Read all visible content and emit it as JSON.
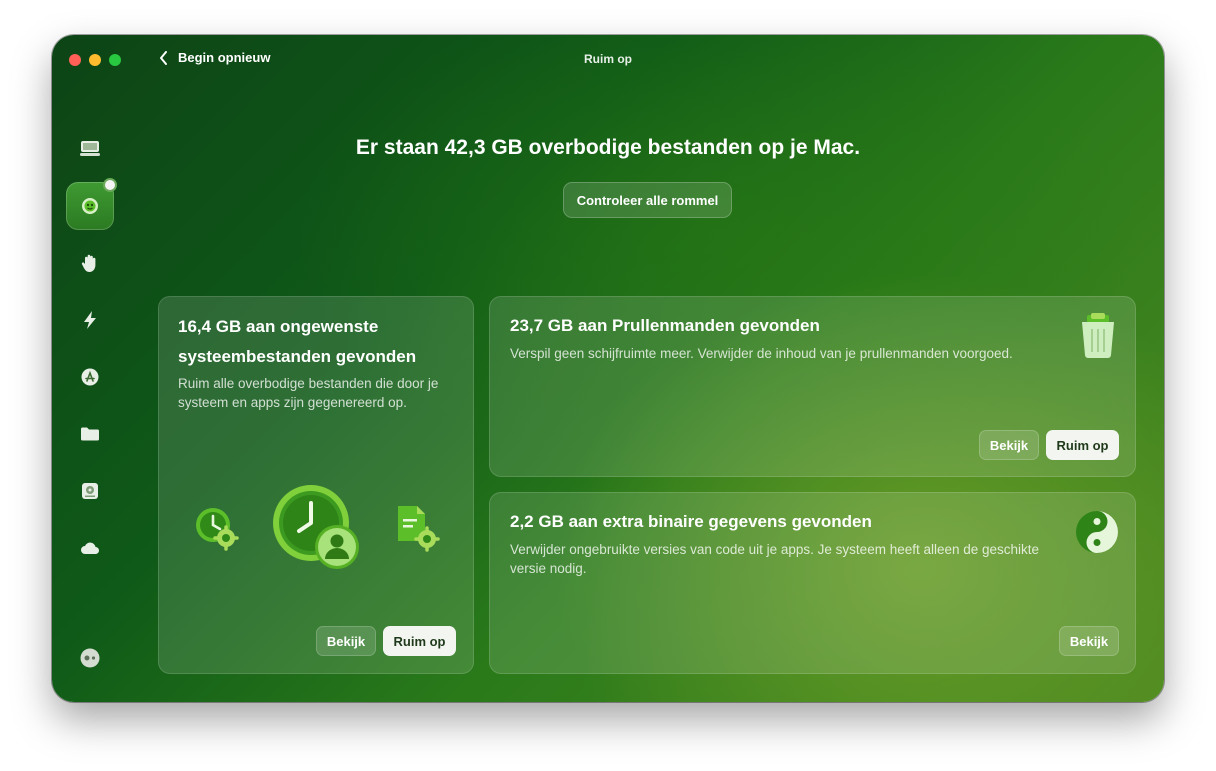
{
  "window": {
    "title": "Ruim op",
    "back_label": "Begin opnieuw"
  },
  "sidebar": {
    "items": [
      {
        "icon": "monitor-icon"
      },
      {
        "icon": "cleanup-icon",
        "active": true
      },
      {
        "icon": "hand-icon"
      },
      {
        "icon": "lightning-icon"
      },
      {
        "icon": "app-store-icon"
      },
      {
        "icon": "folder-icon"
      },
      {
        "icon": "disk-icon"
      },
      {
        "icon": "cloud-icon"
      }
    ],
    "bottom_icon": "assistant-icon"
  },
  "main": {
    "headline": "Er staan 42,3 GB overbodige bestanden op je Mac.",
    "review_button": "Controleer alle rommel"
  },
  "cards": {
    "system": {
      "title": "16,4 GB aan ongewenste systeembestanden gevonden",
      "description": "Ruim alle overbodige bestanden die door je systeem en apps zijn gegenereerd op.",
      "review_label": "Bekijk",
      "clean_label": "Ruim op"
    },
    "trash": {
      "title": "23,7 GB aan Prullenmanden gevonden",
      "description": "Verspil geen schijfruimte meer. Verwijder de inhoud van je prullenmanden voorgoed.",
      "review_label": "Bekijk",
      "clean_label": "Ruim op"
    },
    "binaries": {
      "title": "2,2 GB aan extra binaire gegevens gevonden",
      "description": "Verwijder ongebruikte versies van code uit je apps. Je systeem heeft alleen de geschikte versie nodig.",
      "review_label": "Bekijk"
    }
  },
  "colors": {
    "window_dark": "#0d4416",
    "window_light": "#4e8a22",
    "button_solid": "#f3f5f1"
  }
}
